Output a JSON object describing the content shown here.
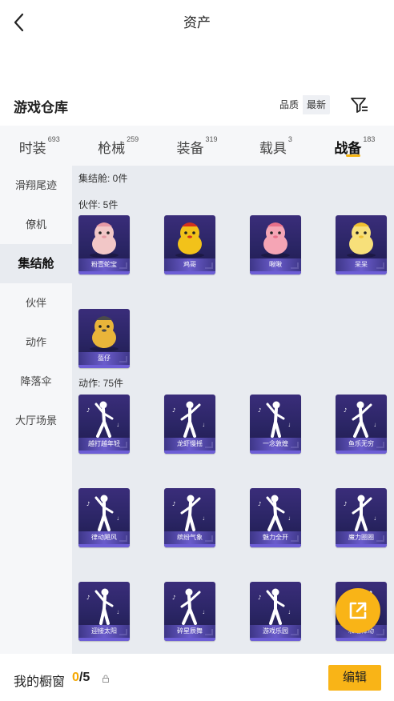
{
  "header": {
    "title": "资产"
  },
  "warehouse": {
    "title": "游戏仓库",
    "sort_options": [
      {
        "label": "品质",
        "selected": false
      },
      {
        "label": "最新",
        "selected": true
      }
    ]
  },
  "tabs": [
    {
      "label": "时装",
      "count": "693",
      "active": false
    },
    {
      "label": "枪械",
      "count": "259",
      "active": false
    },
    {
      "label": "装备",
      "count": "319",
      "active": false
    },
    {
      "label": "载具",
      "count": "3",
      "active": false
    },
    {
      "label": "战备",
      "count": "183",
      "active": true
    }
  ],
  "sidebar": {
    "items": [
      {
        "label": "滑翔尾迹",
        "active": false
      },
      {
        "label": "僚机",
        "active": false
      },
      {
        "label": "集结舱",
        "active": true
      },
      {
        "label": "伙伴",
        "active": false
      },
      {
        "label": "动作",
        "active": false
      },
      {
        "label": "降落伞",
        "active": false
      },
      {
        "label": "大厅场景",
        "active": false
      }
    ]
  },
  "sections": {
    "capsule": {
      "label": "集结舱: 0件"
    },
    "partner": {
      "label": "伙伴: 5件",
      "items": [
        {
          "name": "粉壹蛇宝",
          "icon": "pink-snake-plush"
        },
        {
          "name": "鸡哥",
          "icon": "rooster-mascot"
        },
        {
          "name": "啾啾",
          "icon": "pink-bird-mascot"
        },
        {
          "name": "呆呆",
          "icon": "yellow-chick-mascot"
        },
        {
          "name": "盔仔",
          "icon": "helmet-chick-mascot"
        }
      ]
    },
    "emote": {
      "label": "动作: 75件",
      "items": [
        {
          "name": "越打越年轻",
          "icon": "dance-pose"
        },
        {
          "name": "龙虾慢摇",
          "icon": "dance-pose"
        },
        {
          "name": "一念敦煌",
          "icon": "dance-pose"
        },
        {
          "name": "鱼乐无穷",
          "icon": "dance-pose"
        },
        {
          "name": "律动飓风",
          "icon": "dance-pose"
        },
        {
          "name": "缤纷气象",
          "icon": "dance-pose"
        },
        {
          "name": "魅力全开",
          "icon": "dance-pose"
        },
        {
          "name": "魔力圈圈",
          "icon": "dance-pose"
        },
        {
          "name": "迎接太阳",
          "icon": "dance-pose"
        },
        {
          "name": "碎星辰舞",
          "icon": "dance-pose"
        },
        {
          "name": "游戏乐园",
          "icon": "dance-pose"
        },
        {
          "name": "和谐律动",
          "icon": "dance-pose"
        }
      ]
    }
  },
  "fab": {
    "icon": "share-external-icon"
  },
  "bottom": {
    "label": "我的橱窗",
    "current": "0",
    "separator": "/",
    "max": "5",
    "edit_label": "编辑"
  },
  "colors": {
    "accent": "#f9b417",
    "card_bg": "#2a2564",
    "panel_bg": "#e8ebf0"
  }
}
